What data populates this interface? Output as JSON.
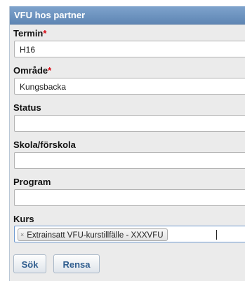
{
  "panel": {
    "title": "VFU hos partner"
  },
  "fields": {
    "termin": {
      "label": "Termin",
      "required_mark": "*",
      "value": "H16"
    },
    "omrade": {
      "label": "Område",
      "required_mark": "*",
      "value": "Kungsbacka"
    },
    "status": {
      "label": "Status",
      "value": ""
    },
    "skola": {
      "label": "Skola/förskola",
      "value": ""
    },
    "program": {
      "label": "Program",
      "value": ""
    },
    "kurs": {
      "label": "Kurs",
      "tags": [
        {
          "remove": "×",
          "label": "Extrainsatt VFU-kurstillfälle - XXXVFU"
        }
      ]
    }
  },
  "buttons": {
    "search": "Sök",
    "clear": "Rensa"
  },
  "colors": {
    "header": "#6a8fbc",
    "panel_bg": "#ebebeb",
    "required": "#d8000c",
    "button_text": "#2f5d8e"
  }
}
